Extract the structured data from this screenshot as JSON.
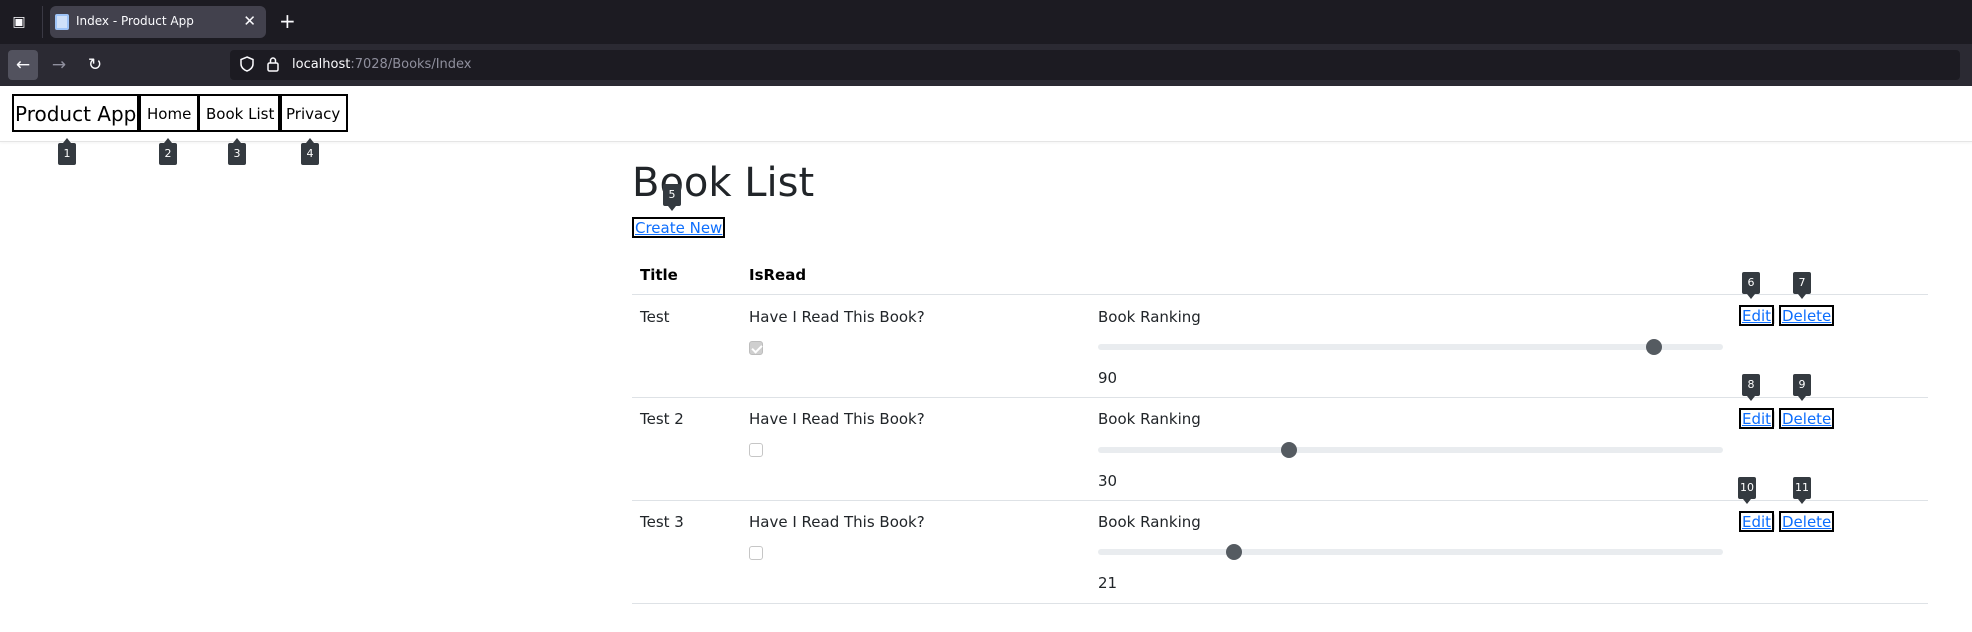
{
  "browser": {
    "tab_title": "Index - Product App",
    "url_host": "localhost",
    "url_path": ":7028/Books/Index"
  },
  "site": {
    "brand": "Product App",
    "nav": [
      "Home",
      "Book List",
      "Privacy"
    ]
  },
  "main": {
    "heading": "Book List",
    "create_link": "Create New",
    "columns": [
      "Title",
      "IsRead"
    ],
    "rows": [
      {
        "title": "Test",
        "read_question": "Have I Read This Book?",
        "is_read": true,
        "ranking_label": "Book Ranking",
        "ranking": 90,
        "ranking_fraction": 0.9,
        "edit": "Edit",
        "delete": "Delete"
      },
      {
        "title": "Test 2",
        "read_question": "Have I Read This Book?",
        "is_read": false,
        "ranking_label": "Book Ranking",
        "ranking": 30,
        "ranking_fraction": 0.3,
        "edit": "Edit",
        "delete": "Delete"
      },
      {
        "title": "Test 3",
        "read_question": "Have I Read This Book?",
        "is_read": false,
        "ranking_label": "Book Ranking",
        "ranking": 21,
        "ranking_fraction": 0.21,
        "edit": "Edit",
        "delete": "Delete"
      }
    ],
    "separator": "|"
  },
  "markers": [
    "1",
    "2",
    "3",
    "4",
    "5",
    "6",
    "7",
    "8",
    "9",
    "10",
    "11"
  ],
  "colors": {
    "link": "#0d6efd",
    "chrome_dark": "#1c1b22",
    "toolbar": "#2b2a33",
    "marker": "#343a40"
  }
}
